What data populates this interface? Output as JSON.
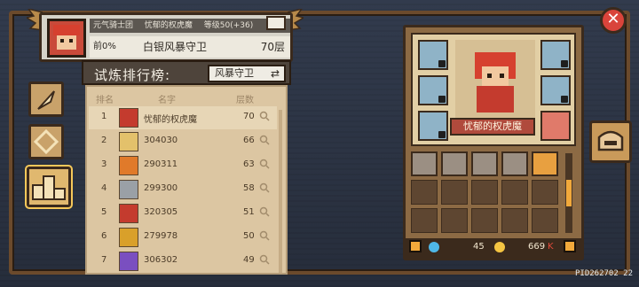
{
  "header": {
    "guild": "元气骑士团",
    "player_name": "忧郁的权虎魔",
    "level_text": "等级50(+36)",
    "progress": "前0%",
    "rank_title": "白银风暴守卫",
    "floor": "70层"
  },
  "board": {
    "title": "试炼排行榜:",
    "mode": "风暴守卫",
    "columns": {
      "rank": "排名",
      "name": "名字",
      "floor": "层数"
    },
    "rows": [
      {
        "rank": "1",
        "name": "忧郁的权虎魔",
        "floor": "70",
        "avatar_color": "#c43b2e"
      },
      {
        "rank": "2",
        "name": "304030",
        "floor": "66",
        "avatar_color": "#e3c16b"
      },
      {
        "rank": "3",
        "name": "290311",
        "floor": "63",
        "avatar_color": "#e07a2a"
      },
      {
        "rank": "4",
        "name": "299300",
        "floor": "58",
        "avatar_color": "#9aa0a6"
      },
      {
        "rank": "5",
        "name": "320305",
        "floor": "51",
        "avatar_color": "#c43b2e"
      },
      {
        "rank": "6",
        "name": "279978",
        "floor": "50",
        "avatar_color": "#d9a02a"
      },
      {
        "rank": "7",
        "name": "306302",
        "floor": "49",
        "avatar_color": "#7a4fc0"
      }
    ]
  },
  "equipment": {
    "character_label": "忧郁的权虎魔",
    "gems": "45",
    "coins": "669",
    "coins_suffix": "K"
  },
  "footer": {
    "pid": "PID262702 22"
  },
  "colors": {
    "accent": "#f2a93b",
    "panel": "#dcc6a2",
    "close": "#d9443b"
  }
}
